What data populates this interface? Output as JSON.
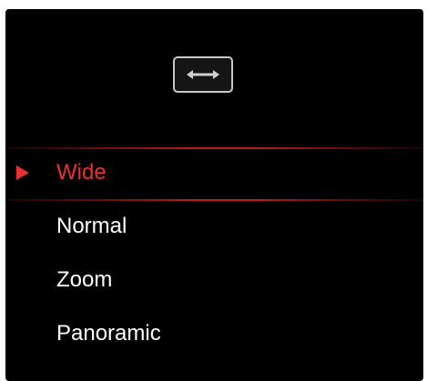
{
  "header": {
    "icon": "aspect-ratio-wide-icon"
  },
  "menu": {
    "selected_index": 0,
    "items": [
      {
        "label": "Wide",
        "selected": true
      },
      {
        "label": "Normal",
        "selected": false
      },
      {
        "label": "Zoom",
        "selected": false
      },
      {
        "label": "Panoramic",
        "selected": false
      }
    ]
  },
  "colors": {
    "background": "#000000",
    "text": "#ffffff",
    "accent": "#e8322b",
    "icon_border": "#c8c8c8"
  }
}
